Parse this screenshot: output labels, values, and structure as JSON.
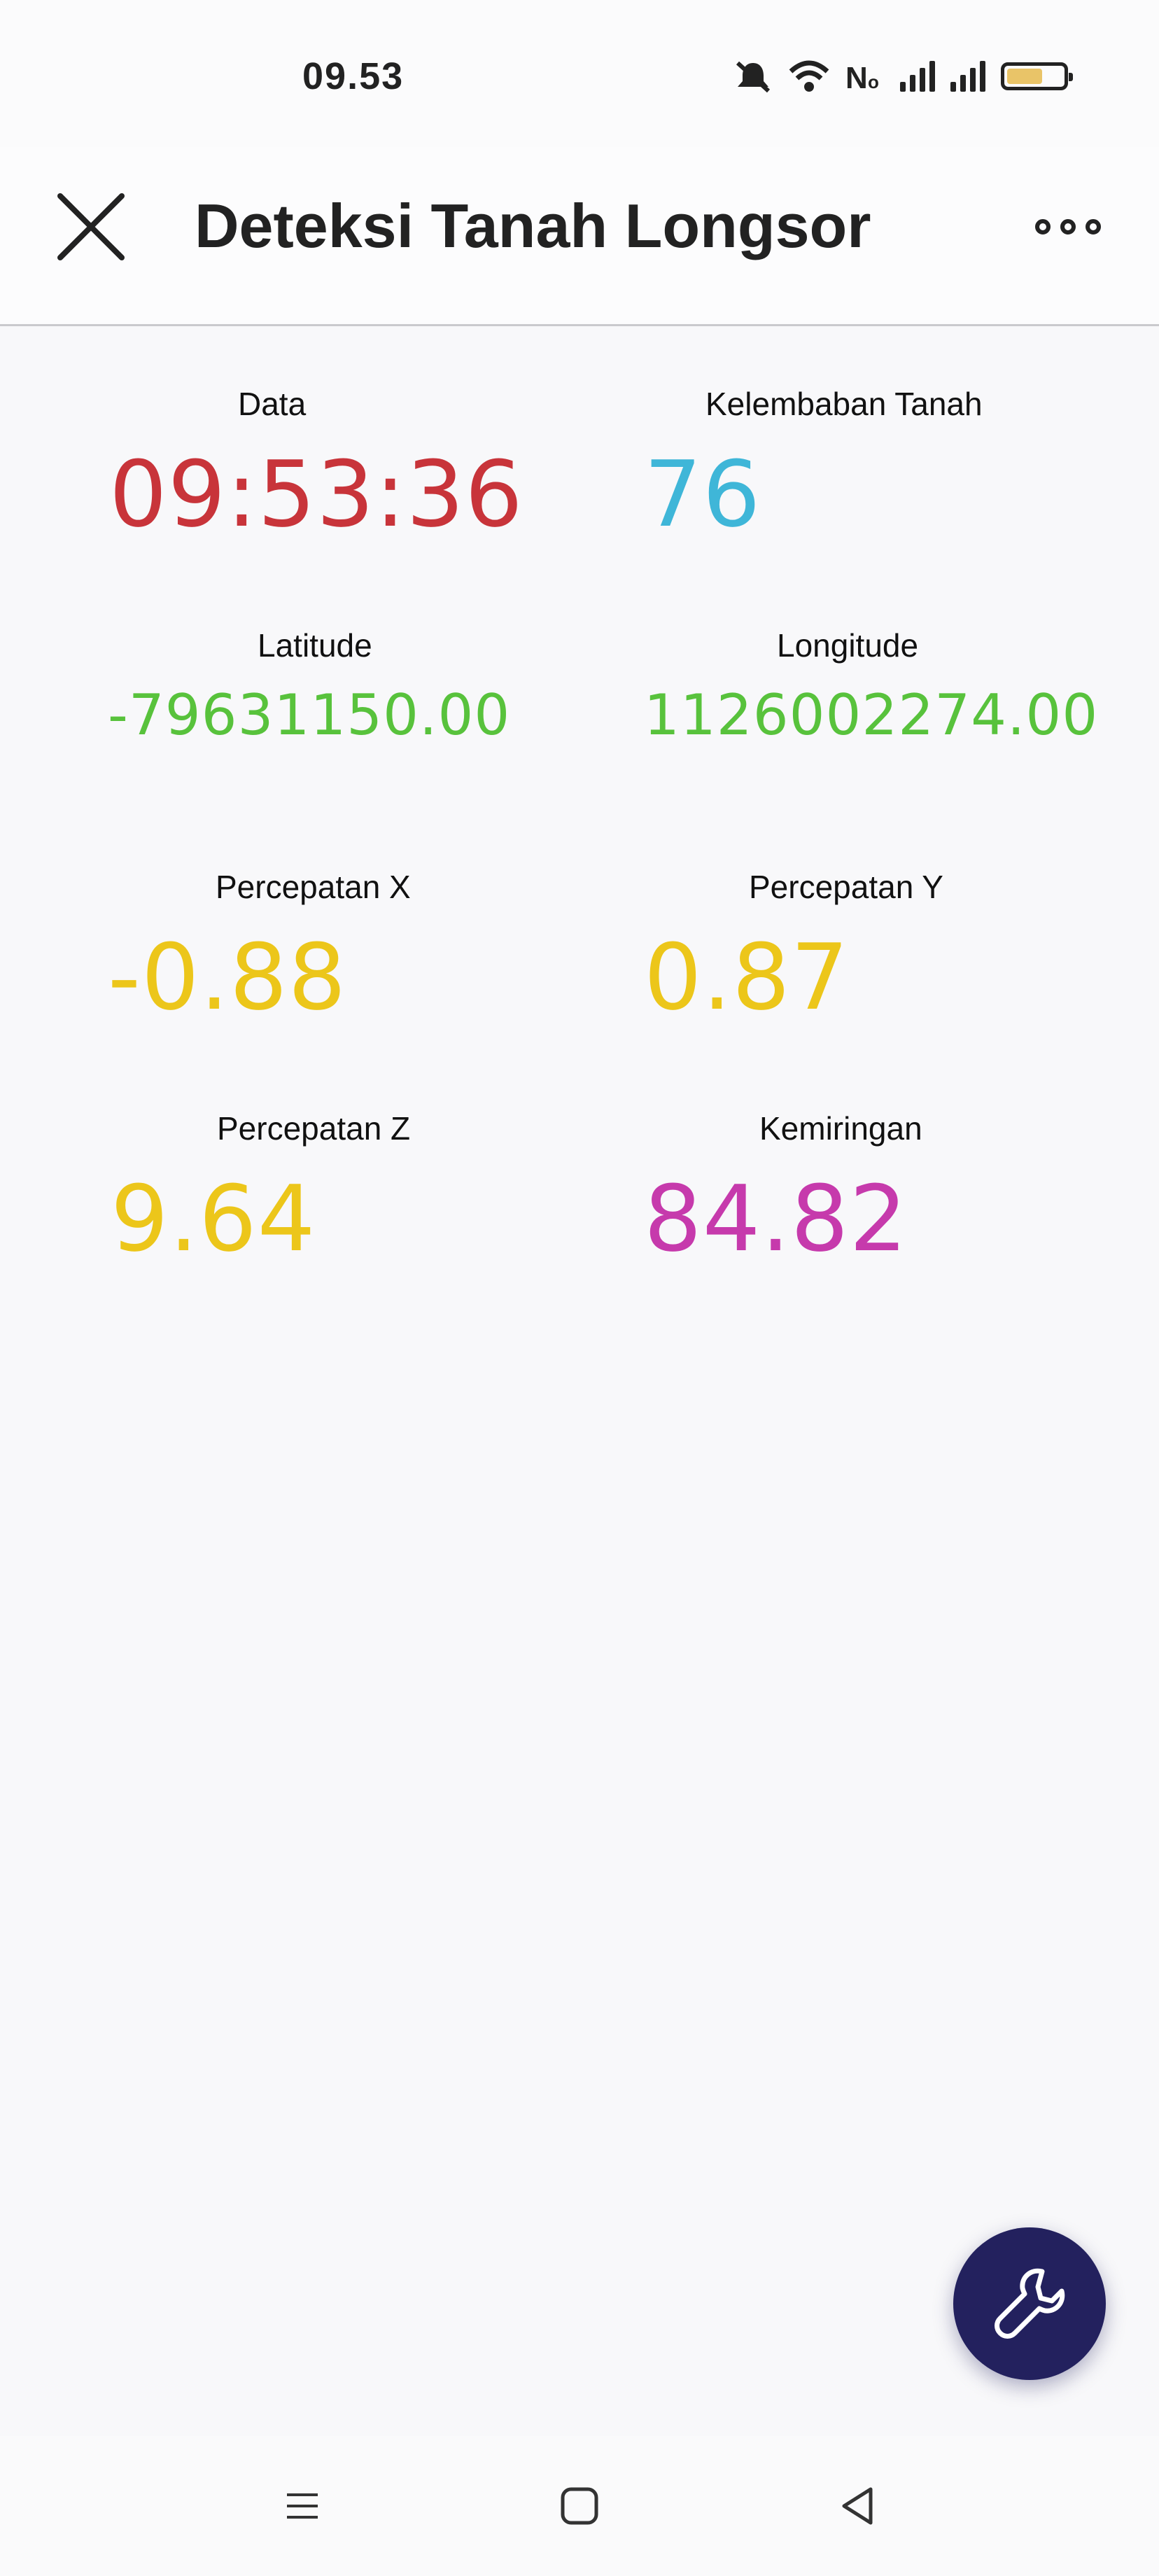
{
  "status_bar": {
    "time": "09.53"
  },
  "app_bar": {
    "title": "Deteksi Tanah Longsor"
  },
  "readings": [
    {
      "label": "Data",
      "value": "09:53:36",
      "color": "#c8343a"
    },
    {
      "label": "Kelembaban Tanah",
      "value": "76",
      "color": "#3fb6d8"
    },
    {
      "label": "Latitude",
      "value": "-79631150.00",
      "color": "#58c23c"
    },
    {
      "label": "Longitude",
      "value": "1126002274.00",
      "color": "#58c23c"
    },
    {
      "label": "Percepatan X",
      "value": "-0.88",
      "color": "#ecc61a"
    },
    {
      "label": "Percepatan Y",
      "value": "0.87",
      "color": "#ecc61a"
    },
    {
      "label": "Percepatan Z",
      "value": "9.64",
      "color": "#ecc61a"
    },
    {
      "label": "Kemiringan",
      "value": "84.82",
      "color": "#c63aac"
    }
  ],
  "icons": {
    "close": "close-icon",
    "more": "more-icon",
    "fab": "wrench-icon",
    "nav_menu": "menu-icon",
    "nav_home": "home-icon",
    "nav_back": "back-icon"
  },
  "colors": {
    "fab_background": "#23215e",
    "background": "#f8f8fa"
  }
}
